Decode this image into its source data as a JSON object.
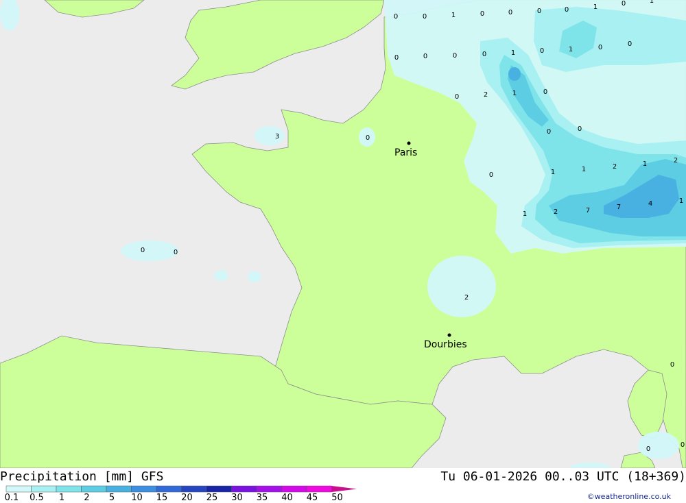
{
  "map": {
    "cities": [
      {
        "name": "Paris"
      },
      {
        "name": "Dourbies"
      }
    ],
    "value_labels": [
      "0",
      "0",
      "1",
      "0",
      "0",
      "0",
      "0",
      "1",
      "0",
      "1",
      "0",
      "0",
      "0",
      "0",
      "1",
      "0",
      "1",
      "0",
      "0",
      "0",
      "2",
      "1",
      "0",
      "0",
      "0",
      "1",
      "0",
      "1",
      "2",
      "1",
      "2",
      "2",
      "1",
      "7",
      "7",
      "4",
      "1",
      "2",
      "3",
      "0",
      "0",
      "0",
      "0",
      "0",
      "0"
    ]
  },
  "footer": {
    "title": "Precipitation [mm] GFS",
    "datetime": "Tu 06-01-2026 00..03 UTC (18+369)",
    "credit": "©weatheronline.co.uk",
    "legend": {
      "labels": [
        "0.1",
        "0.5",
        "1",
        "2",
        "5",
        "10",
        "15",
        "20",
        "25",
        "30",
        "35",
        "40",
        "45",
        "50"
      ],
      "colors": [
        "#d2f8fa",
        "#a8f0f2",
        "#7fe4ea",
        "#5ccde3",
        "#48b1e2",
        "#3c8fe0",
        "#3169d8",
        "#2646bf",
        "#1a25a6",
        "#7a12e0",
        "#a410e8",
        "#d20ae8",
        "#f00ae0",
        "#c8108c"
      ]
    },
    "colors": {
      "land": "#ccff99",
      "sea": "#ececec",
      "border": "#8c8c8c"
    }
  }
}
